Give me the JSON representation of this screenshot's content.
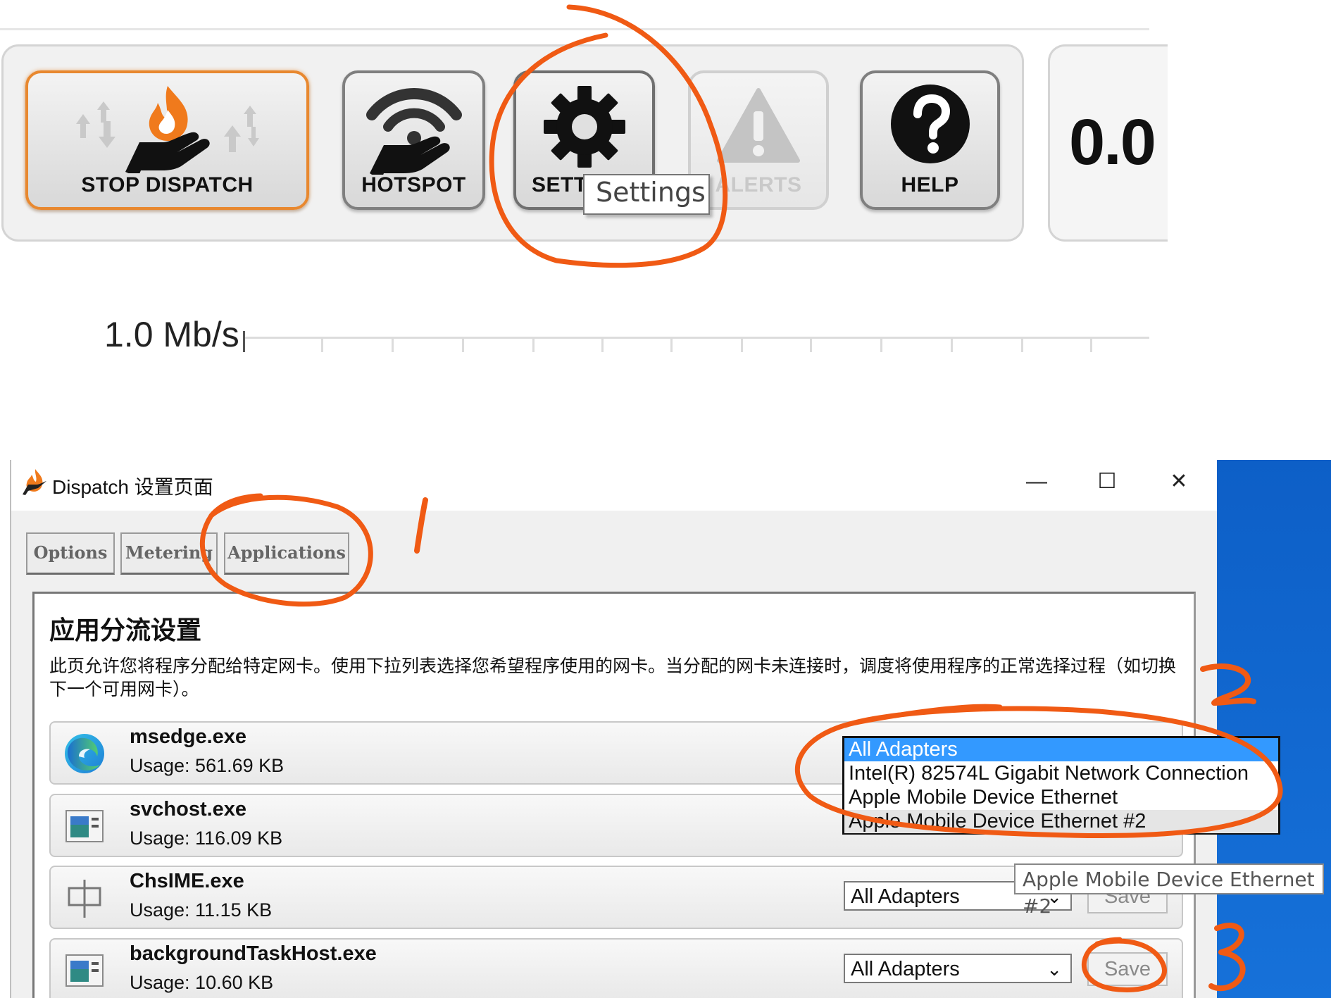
{
  "toolbar": {
    "stop_dispatch_label": "STOP DISPATCH",
    "hotspot_label": "HOTSPOT",
    "settings_label": "SETT",
    "alerts_label": "ALERTS",
    "help_label": "HELP",
    "speed_value": "0.0",
    "settings_tooltip": "Settings",
    "accent_color": "#e8882f"
  },
  "graph": {
    "y_label": "1.0 Mb/s"
  },
  "window": {
    "title": "Dispatch 设置页面",
    "minimize": "—",
    "maximize": "☐",
    "close": "✕",
    "tabs": [
      {
        "label": "Options"
      },
      {
        "label": "Metering"
      },
      {
        "label": "Applications"
      }
    ],
    "panel_title": "应用分流设置",
    "panel_desc": "此页允许您将程序分配给特定网卡。使用下拉列表选择您希望程序使用的网卡。当分配的网卡未连接时，调度将使用程序的正常选择过程（如切换下一个可用网卡）。",
    "apps": [
      {
        "name": "msedge.exe",
        "usage": "Usage: 561.69 KB",
        "icon": "edge-icon"
      },
      {
        "name": "svchost.exe",
        "usage": "Usage: 116.09 KB",
        "icon": "app-window-icon"
      },
      {
        "name": "ChsIME.exe",
        "usage": "Usage: 11.15 KB",
        "icon": "ime-icon",
        "adapter": "All Adapters",
        "save": "Save"
      },
      {
        "name": "backgroundTaskHost.exe",
        "usage": "Usage: 10.60 KB",
        "icon": "app-window-icon",
        "adapter": "All Adapters",
        "save": "Save"
      }
    ],
    "dropdown_options": [
      "All Adapters",
      "Intel(R) 82574L Gigabit Network Connection",
      "Apple Mobile Device Ethernet",
      "Apple Mobile Device Ethernet #2"
    ],
    "hover_tooltip": "Apple Mobile Device Ethernet #2"
  },
  "annotations": {
    "step1": "1",
    "step2": "2",
    "step3": "3",
    "color": "#f05a14"
  }
}
